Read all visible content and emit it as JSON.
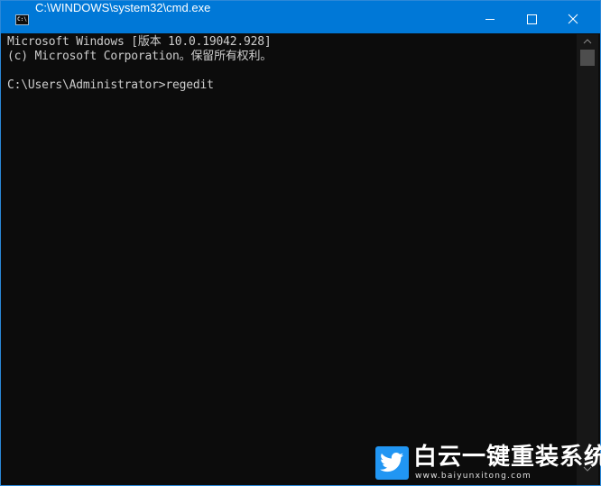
{
  "window": {
    "title": "C:\\WINDOWS\\system32\\cmd.exe",
    "app_icon_text": "C:\\",
    "controls": {
      "minimize": "minimize-icon",
      "maximize": "maximize-icon",
      "close": "close-icon"
    }
  },
  "console": {
    "lines": [
      "Microsoft Windows [版本 10.0.19042.928]",
      "(c) Microsoft Corporation。保留所有权利。",
      "",
      "C:\\Users\\Administrator>regedit"
    ]
  },
  "watermark": {
    "brand": "白云一键重装系统",
    "url": "www.baiyunxitong.com",
    "logo_icon": "twitter-bird-icon",
    "color": "#2196f3"
  },
  "colors": {
    "titlebar": "#0078d7",
    "console_bg": "#0c0c0c",
    "console_text": "#cccccc"
  }
}
